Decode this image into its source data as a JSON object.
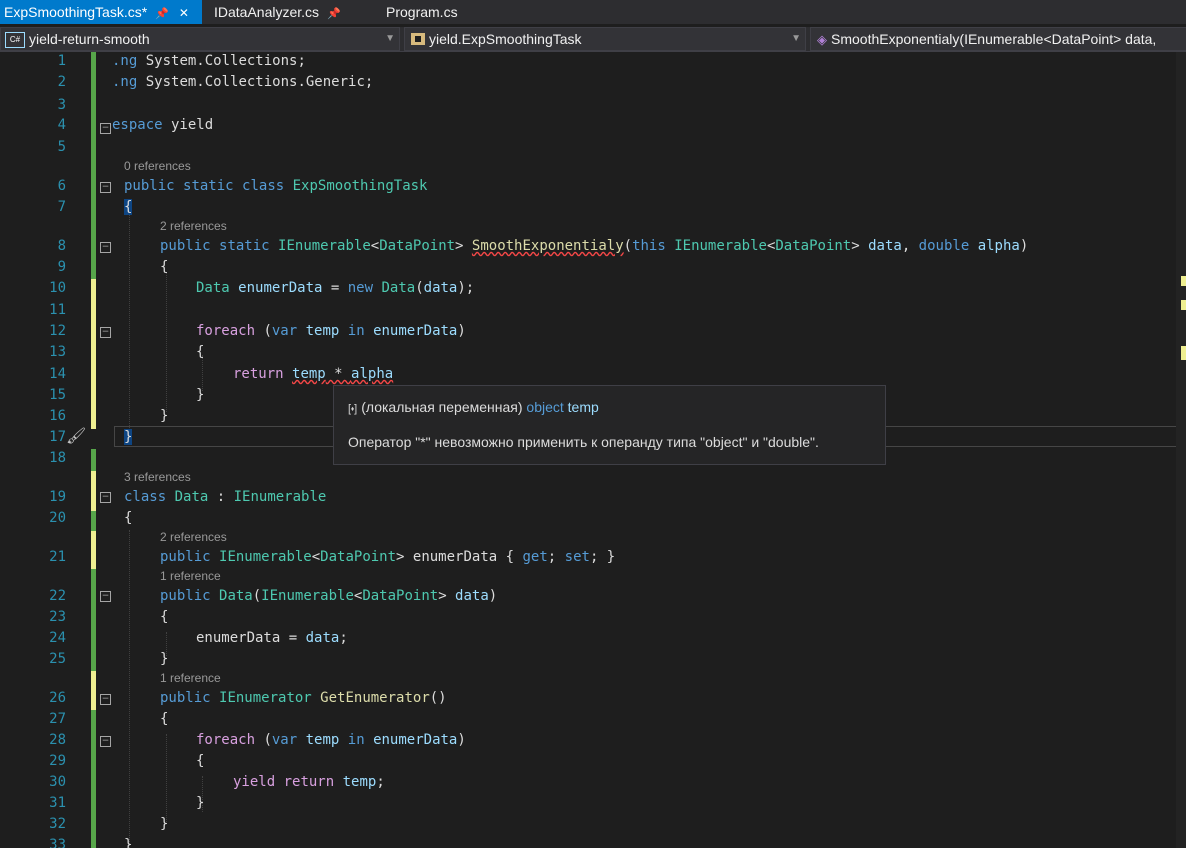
{
  "tabs": [
    {
      "label": "ExpSmoothingTask.cs*",
      "pinned": true,
      "active": true
    },
    {
      "label": "IDataAnalyzer.cs",
      "pinned": true,
      "active": false
    },
    {
      "label": "Program.cs",
      "pinned": false,
      "active": false
    }
  ],
  "nav": {
    "project_icon": "C#",
    "project": "yield-return-smooth",
    "class": "yield.ExpSmoothingTask",
    "member": "SmoothExponentialy(IEnumerable<DataPoint> data,"
  },
  "line_numbers": [
    "1",
    "2",
    "3",
    "4",
    "5",
    "6",
    "7",
    "8",
    "9",
    "10",
    "11",
    "12",
    "13",
    "14",
    "15",
    "16",
    "17",
    "18",
    "19",
    "20",
    "21",
    "22",
    "23",
    "24",
    "25",
    "26",
    "27",
    "28",
    "29",
    "30",
    "31",
    "32",
    "33"
  ],
  "references": {
    "r6": "0 references",
    "r8": "2 references",
    "r19": "3 references",
    "r21": "2 references",
    "r22": "1 reference",
    "r26": "1 reference"
  },
  "code": {
    "l1_kw": ".ng",
    "l1_rest": " System.Collections;",
    "l2_kw": ".ng",
    "l2_rest": " System.Collections.Generic;",
    "l4_kw": "espace",
    "l4_rest": " yield",
    "l6_a": "public",
    "l6_b": "static",
    "l6_c": "class",
    "l6_name": "ExpSmoothingTask",
    "brace_open": "{",
    "brace_close": "}",
    "l8_a": "public",
    "l8_b": "static",
    "l8_t1": "IEnumerable",
    "l8_t2": "DataPoint",
    "l8_fn": "SmoothExponentialy",
    "l8_this": "this",
    "l8_t3": "IEnumerable",
    "l8_t4": "DataPoint",
    "l8_p1": "data",
    "l8_dbl": "double",
    "l8_p2": "alpha",
    "l10_ty": "Data",
    "l10_var": "enumerData",
    "l10_new": "new",
    "l10_ty2": "Data",
    "l10_arg": "data",
    "l12_fe": "foreach",
    "l12_var": "var",
    "l12_t": "temp",
    "l12_in": "in",
    "l12_src": "enumerData",
    "l14_ret": "return",
    "l14_t": "temp",
    "l14_op": " * ",
    "l14_a": "alpha",
    "l19_cls": "class",
    "l19_name": "Data",
    "l19_base": "IEnumerable",
    "l21_pub": "public",
    "l21_t1": "IEnumerable",
    "l21_t2": "DataPoint",
    "l21_prop": "enumerData",
    "l21_get": "get",
    "l21_set": "set",
    "l22_pub": "public",
    "l22_name": "Data",
    "l22_t1": "IEnumerable",
    "l22_t2": "DataPoint",
    "l22_p": "data",
    "l24_lhs": "enumerData",
    "l24_rhs": "data",
    "l26_pub": "public",
    "l26_t": "IEnumerator",
    "l26_fn": "GetEnumerator",
    "l28_fe": "foreach",
    "l28_var": "var",
    "l28_t": "temp",
    "l28_in": "in",
    "l28_src": "enumerData",
    "l30_y": "yield",
    "l30_r": "return",
    "l30_t": "temp"
  },
  "tooltip": {
    "prefix": "(локальная переменная)",
    "type": "object",
    "name": "temp",
    "message": "Оператор \"*\" невозможно применить к операнду типа \"object\" и \"double\"."
  },
  "colors": {
    "accent": "#007acc",
    "keyword": "#569cd6",
    "type": "#4ec9b0",
    "method": "#dcdcaa",
    "identifier": "#9cdcfe",
    "control": "#d8a0df",
    "error": "#f44747"
  },
  "icons": {
    "pin": "pin-icon",
    "tooltip": "local-variable-icon",
    "gutter": "quick-action-brush-icon"
  }
}
